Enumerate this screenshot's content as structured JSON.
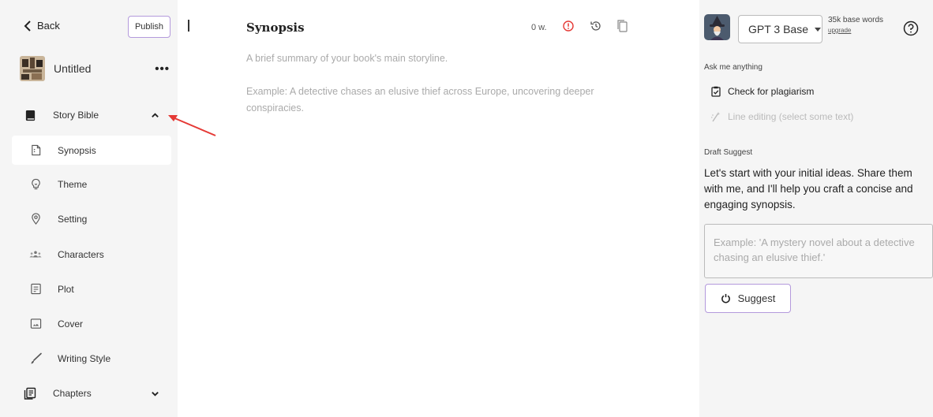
{
  "sidebar": {
    "back_label": "Back",
    "publish_label": "Publish",
    "book_title": "Untitled",
    "more_label": "•••",
    "story_bible_label": "Story Bible",
    "items": [
      {
        "label": "Synopsis",
        "icon": "synopsis-icon",
        "active": true
      },
      {
        "label": "Theme",
        "icon": "lightbulb-icon",
        "active": false
      },
      {
        "label": "Setting",
        "icon": "location-pin-icon",
        "active": false
      },
      {
        "label": "Characters",
        "icon": "people-icon",
        "active": false
      },
      {
        "label": "Plot",
        "icon": "plot-icon",
        "active": false
      },
      {
        "label": "Cover",
        "icon": "image-icon",
        "active": false
      },
      {
        "label": "Writing Style",
        "icon": "brush-icon",
        "active": false
      }
    ],
    "chapters_label": "Chapters"
  },
  "editor": {
    "title": "Synopsis",
    "word_count": "0 w.",
    "description": "A brief summary of your book's main storyline.",
    "example": "Example: A detective chases an elusive thief across Europe, uncovering deeper conspiracies."
  },
  "panel": {
    "model": "GPT 3 Base",
    "words_label": "35k base words",
    "upgrade_label": "upgrade",
    "ask_label": "Ask me anything",
    "plagiarism_label": "Check for plagiarism",
    "line_editing_label": "Line editing (select some text)",
    "draft_label": "Draft Suggest",
    "draft_text": "Let's start with your initial ideas. Share them with me, and I'll help you craft a concise and engaging synopsis.",
    "input_placeholder": "Example: 'A mystery novel about a detective chasing an elusive thief.'",
    "suggest_label": "Suggest"
  },
  "colors": {
    "sidebar_bg": "#f5f5f5",
    "accent_border": "#b49adc",
    "alert_red": "#e53935",
    "annotation_red": "#e53935"
  }
}
